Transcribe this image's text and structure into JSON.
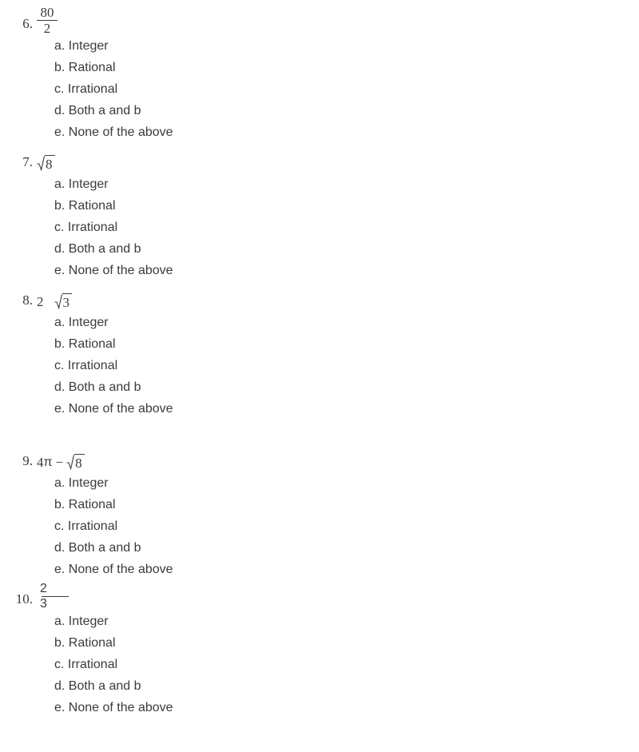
{
  "document": {
    "type": "math-worksheet",
    "text_color": "#3b3b3b",
    "background_color": "#ffffff",
    "questions": [
      {
        "number": "6.",
        "expression_kind": "fraction",
        "numerator": "80",
        "denominator": "2",
        "expression_text": "80/2",
        "options": [
          "a. Integer",
          "b. Rational",
          "c. Irrational",
          "d. Both a and b",
          "e. None of the above"
        ]
      },
      {
        "number": "7.",
        "expression_kind": "radical",
        "radicand": "8",
        "expression_text": "√8",
        "options": [
          "a. Integer",
          "b. Rational",
          "c. Irrational",
          "d. Both a and b",
          "e. None of the above"
        ]
      },
      {
        "number": "8.",
        "expression_kind": "coefficient-radical",
        "coefficient": "2",
        "radicand": "3",
        "expression_text": "2 √3",
        "options": [
          "a. Integer",
          "b. Rational",
          "c. Irrational",
          "d. Both a and b",
          "e. None of the above"
        ]
      },
      {
        "number": "9.",
        "expression_kind": "pi-minus-radical",
        "coefficient": "4",
        "symbol": "π",
        "operator": "−",
        "radicand": "8",
        "expression_text": "4π − √8",
        "options": [
          "a. Integer",
          "b. Rational",
          "c. Irrational",
          "d. Both a and b",
          "e. None of the above"
        ]
      },
      {
        "number": "10.",
        "expression_kind": "fraction",
        "numerator": "2",
        "denominator": "3",
        "expression_text": "2/3",
        "options": [
          "a. Integer",
          "b. Rational",
          "c. Irrational",
          "d. Both a and b",
          "e. None of the above"
        ]
      }
    ]
  }
}
